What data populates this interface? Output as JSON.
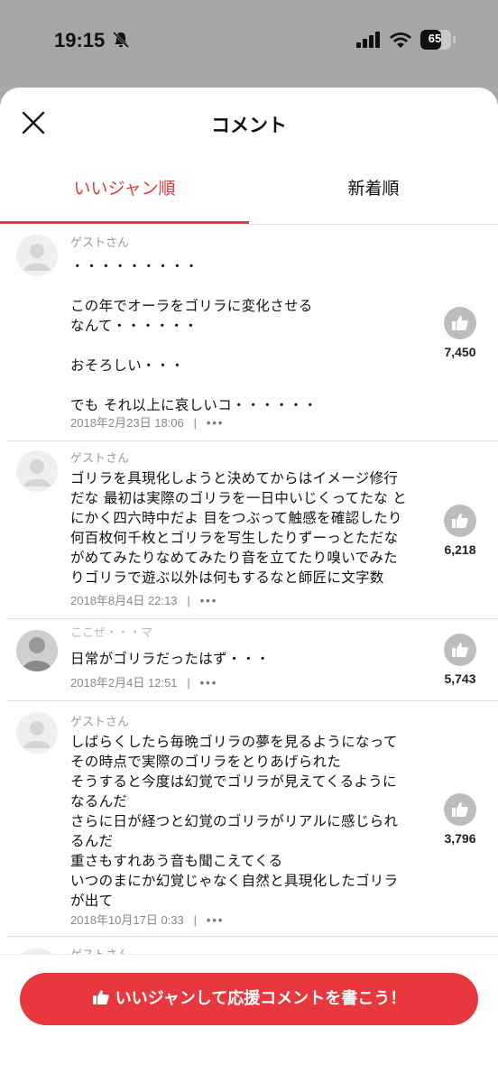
{
  "status_bar": {
    "time": "19:15",
    "battery": "65"
  },
  "header": {
    "title": "コメント",
    "close_icon": "close-icon"
  },
  "tabs": [
    {
      "label": "いいジャン順",
      "active": true
    },
    {
      "label": "新着順",
      "active": false
    }
  ],
  "comments": [
    {
      "author": "ゲストさん",
      "body": "・・・・・・・・・\n\nこの年でオーラをゴリラに変化させる\nなんて・・・・・・\n\nおそろしい・・・\n\nでも それ以上に哀しいコ・・・・・・",
      "date": "2018年2月23日 18:06",
      "likes": "7,450"
    },
    {
      "author": "ゲストさん",
      "body": "ゴリラを具現化しようと決めてからはイメージ修行\nだな 最初は実際のゴリラを一日中いじくってたな と\nにかく四六時中だよ 目をつぶって触感を確認したり\n何百枚何千枚とゴリラを写生したりずーっとただな\nがめてみたりなめてみたり音を立てたり嗅いでみた\nりゴリラで遊ぶ以外は何もするなと師匠に文字数",
      "date": "2018年8月4日 22:13",
      "likes": "6,218"
    },
    {
      "author": "ここぜ・・・マ",
      "body": "日常がゴリラだったはず・・・",
      "date": "2018年2月4日 12:51",
      "likes": "5,743"
    },
    {
      "author": "ゲストさん",
      "body": "しばらくしたら毎晩ゴリラの夢を見るようになって\nその時点で実際のゴリラをとりあげられた\nそうすると今度は幻覚でゴリラが見えてくるように\nなるんだ\nさらに日が経つと幻覚のゴリラがリアルに感じられ\nるんだ\n重さもすれあう音も聞こえてくる\nいつのまにか幻覚じゃなく自然と具現化したゴリラ\nが出て",
      "date": "2018年10月17日 0:33",
      "likes": "3,796"
    },
    {
      "author": "ゲストさん",
      "body": "",
      "date": "",
      "likes": ""
    }
  ],
  "footer": {
    "cta_label": "いいジャンして応援コメントを書こう！"
  },
  "colors": {
    "accent": "#e8383d",
    "like_gray": "#bdbdbd"
  }
}
